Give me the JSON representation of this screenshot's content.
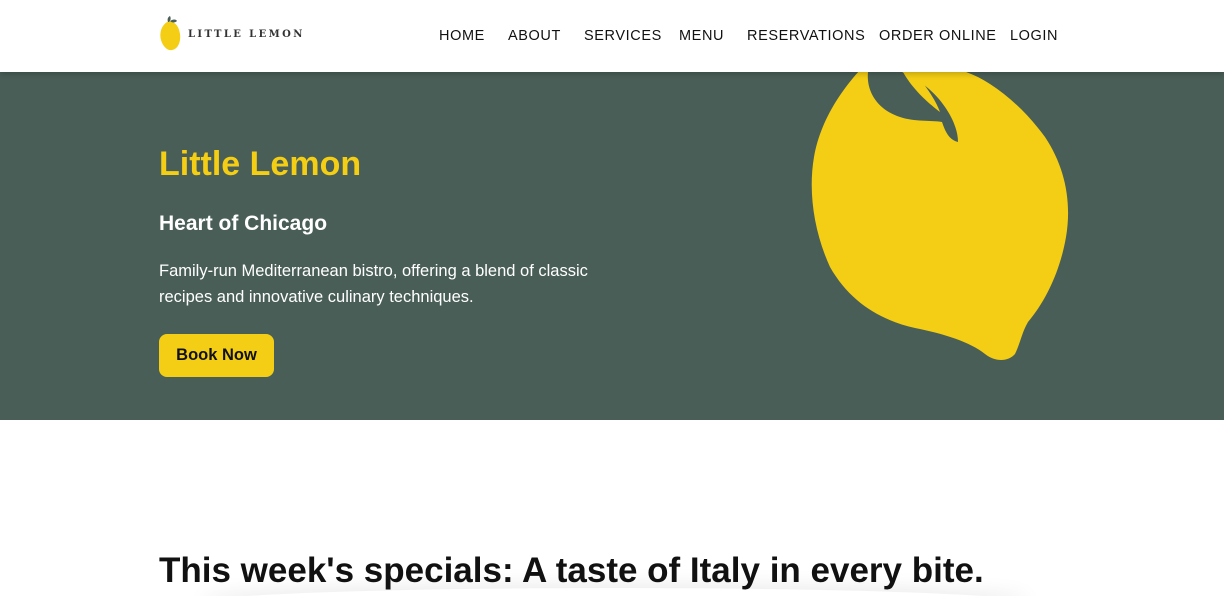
{
  "header": {
    "logo_text": "LITTLE LEMON",
    "nav": [
      {
        "label": "HOME"
      },
      {
        "label": "ABOUT"
      },
      {
        "label": "SERVICES"
      },
      {
        "label": "MENU"
      },
      {
        "label": "RESERVATIONS"
      },
      {
        "label": "ORDER ONLINE"
      },
      {
        "label": "LOGIN"
      }
    ]
  },
  "hero": {
    "title": "Little Lemon",
    "subtitle": "Heart of Chicago",
    "description": "Family-run Mediterranean bistro, offering a blend of classic recipes and innovative culinary techniques.",
    "cta_label": "Book Now",
    "image_icon": "lemon-illustration"
  },
  "specials": {
    "title": "This week's specials: A taste of Italy in every bite."
  },
  "colors": {
    "primary_green": "#495e57",
    "primary_yellow": "#f4ce14",
    "text_dark": "#111111",
    "background": "#ffffff"
  }
}
